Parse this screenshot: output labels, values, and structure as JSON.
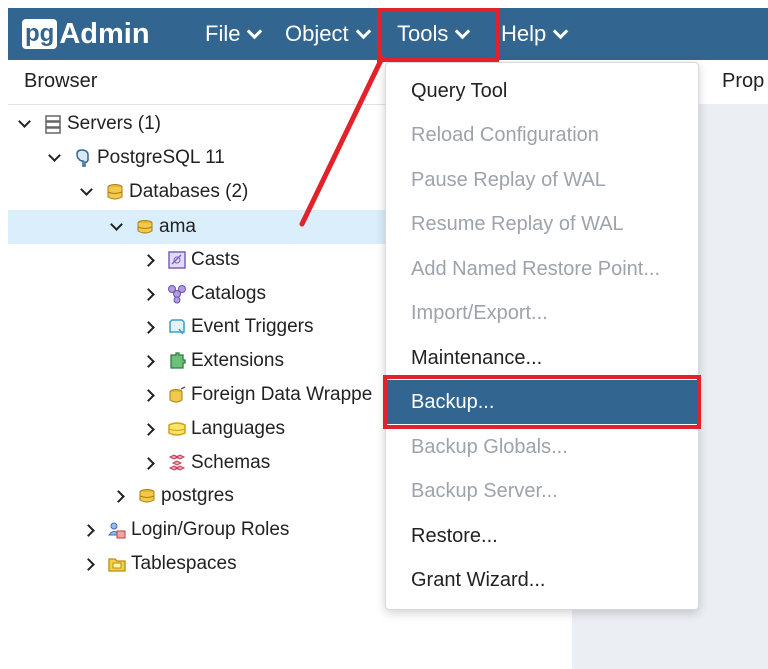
{
  "app": {
    "logo_pg": "pg",
    "logo_text": "Admin"
  },
  "menubar": [
    {
      "label": "File"
    },
    {
      "label": "Object"
    },
    {
      "label": "Tools"
    },
    {
      "label": "Help"
    }
  ],
  "panels": {
    "browser_title": "Browser",
    "properties_title": "Prop"
  },
  "tree": [
    {
      "label": "Servers (1)",
      "icon": "servers-icon",
      "expanded": true
    },
    {
      "label": "PostgreSQL 11",
      "icon": "postgresql-elephant-icon",
      "expanded": true
    },
    {
      "label": "Databases (2)",
      "icon": "databases-icon",
      "expanded": true
    },
    {
      "label": "ama",
      "icon": "database-icon",
      "expanded": true,
      "selected": true
    },
    {
      "label": "Casts",
      "icon": "casts-icon",
      "expanded": false
    },
    {
      "label": "Catalogs",
      "icon": "catalogs-icon",
      "expanded": false
    },
    {
      "label": "Event Triggers",
      "icon": "event-triggers-icon",
      "expanded": false
    },
    {
      "label": "Extensions",
      "icon": "extensions-icon",
      "expanded": false
    },
    {
      "label": "Foreign Data Wrappe",
      "icon": "foreign-data-wrappers-icon",
      "expanded": false
    },
    {
      "label": "Languages",
      "icon": "languages-icon",
      "expanded": false
    },
    {
      "label": "Schemas",
      "icon": "schemas-icon",
      "expanded": false
    },
    {
      "label": "postgres",
      "icon": "database-icon",
      "expanded": false
    },
    {
      "label": "Login/Group Roles",
      "icon": "roles-icon",
      "expanded": false
    },
    {
      "label": "Tablespaces",
      "icon": "tablespaces-icon",
      "expanded": false
    }
  ],
  "tools_menu": [
    {
      "label": "Query Tool",
      "state": "enabled"
    },
    {
      "label": "Reload Configuration",
      "state": "disabled"
    },
    {
      "label": "Pause Replay of WAL",
      "state": "disabled"
    },
    {
      "label": "Resume Replay of WAL",
      "state": "disabled"
    },
    {
      "label": "Add Named Restore Point...",
      "state": "disabled"
    },
    {
      "label": "Import/Export...",
      "state": "disabled"
    },
    {
      "label": "Maintenance...",
      "state": "enabled"
    },
    {
      "label": "Backup...",
      "state": "active"
    },
    {
      "label": "Backup Globals...",
      "state": "disabled"
    },
    {
      "label": "Backup Server...",
      "state": "disabled"
    },
    {
      "label": "Restore...",
      "state": "enabled"
    },
    {
      "label": "Grant Wizard...",
      "state": "enabled"
    }
  ],
  "colors": {
    "navbar": "#326690",
    "selected_row": "#dbeefb",
    "annotation": "#e3212b",
    "disabled_text": "#9da3ab"
  }
}
